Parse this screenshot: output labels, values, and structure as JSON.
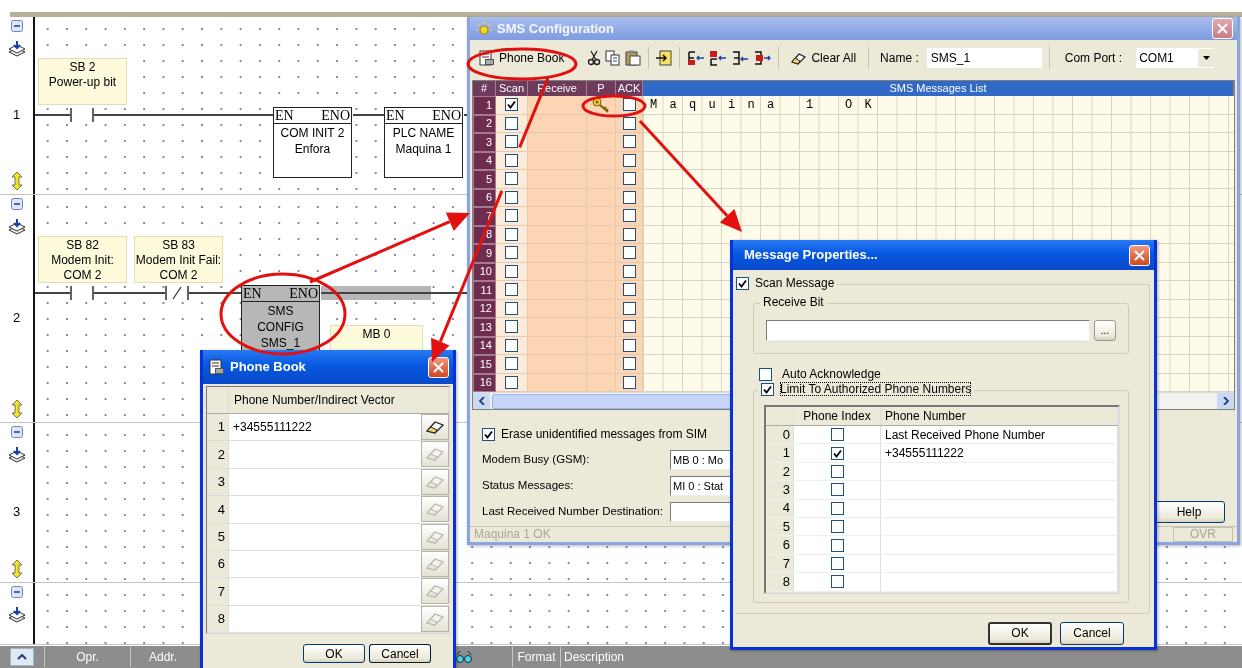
{
  "editor": {
    "rungs": [
      {
        "number": "1",
        "expanded": true,
        "contacts": [
          {
            "text": "SB 2\nPower-up bit",
            "kind": "open"
          }
        ],
        "blocks": [
          {
            "pins": [
              "EN",
              "ENO"
            ],
            "text": "COM INIT 2\nEnfora",
            "selected": false
          },
          {
            "pins": [
              "EN",
              "ENO"
            ],
            "text": "PLC NAME\nMaquina 1",
            "selected": false
          }
        ]
      },
      {
        "number": "2",
        "expanded": true,
        "contacts": [
          {
            "text": "SB 82\nModem Init:\nCOM 2",
            "kind": "open"
          },
          {
            "text": "SB 83\nModem Init Fail:\nCOM 2",
            "kind": "closed"
          }
        ],
        "blocks": [
          {
            "pins": [
              "EN",
              "ENO"
            ],
            "text": "SMS\nCONFIG\nSMS_1",
            "selected": true,
            "tag": "MB 0"
          }
        ]
      },
      {
        "number": "3",
        "expanded": true
      },
      {
        "expanded": true
      }
    ]
  },
  "sms_config": {
    "title": "SMS Configuration",
    "active": false,
    "toolbar": {
      "phone_book": "Phone Book",
      "clear_all": "Clear All",
      "name_label": "Name :",
      "name_value": "SMS_1",
      "com_port_label": "Com Port :",
      "com_port_value": "COM1"
    },
    "grid": {
      "columns": [
        "#",
        "Scan",
        "Receive",
        "P",
        "ACK",
        "SMS Messages List"
      ],
      "rows": [
        {
          "number": "1",
          "scan": true,
          "password": true,
          "ack": false,
          "message": "Maquina 1 OK"
        },
        {
          "number": "2",
          "scan": false,
          "password": false,
          "ack": false
        },
        {
          "number": "3",
          "scan": false,
          "password": false,
          "ack": false
        },
        {
          "number": "4",
          "scan": false,
          "password": false,
          "ack": false
        },
        {
          "number": "5",
          "scan": false,
          "password": false,
          "ack": false
        },
        {
          "number": "6",
          "scan": false,
          "password": false,
          "ack": false
        },
        {
          "number": "7",
          "scan": false,
          "password": false,
          "ack": false
        },
        {
          "number": "8",
          "scan": false,
          "password": false,
          "ack": false
        },
        {
          "number": "9",
          "scan": false,
          "password": false,
          "ack": false
        },
        {
          "number": "10",
          "scan": false,
          "password": false,
          "ack": false
        },
        {
          "number": "11",
          "scan": false,
          "password": false,
          "ack": false
        },
        {
          "number": "12",
          "scan": false,
          "password": false,
          "ack": false
        },
        {
          "number": "13",
          "scan": false,
          "password": false,
          "ack": false
        },
        {
          "number": "14",
          "scan": false,
          "password": false,
          "ack": false
        },
        {
          "number": "15",
          "scan": false,
          "password": false,
          "ack": false
        },
        {
          "number": "16",
          "scan": false,
          "password": false,
          "ack": false
        }
      ]
    },
    "erase_unidentified": {
      "label": "Erase unidentified messages from SIM",
      "checked": true
    },
    "fields": [
      {
        "label": "Modem Busy (GSM):",
        "value": "MB 0 : Mo"
      },
      {
        "label": "Status Messages:",
        "value": "MI 0 : Stat"
      },
      {
        "label": "Last Received Number Destination:"
      }
    ],
    "help": "Help",
    "status": "Maquina 1 OK",
    "mode": "OVR"
  },
  "message_properties": {
    "title": "Message Properties...",
    "active": true,
    "scan_message": {
      "label": "Scan Message",
      "checked": true
    },
    "receive_bit": {
      "legend": "Receive Bit",
      "browse": "..."
    },
    "auto_acknowledge": {
      "label": "Auto Acknowledge",
      "checked": false
    },
    "limit": {
      "label": "Limit To Authorized Phone Numbers",
      "checked": true
    },
    "table": {
      "columns": [
        "Phone Index",
        "Phone Number"
      ],
      "rows": [
        {
          "index": "0",
          "checked": false,
          "number": "Last Received Phone Number"
        },
        {
          "index": "1",
          "checked": true,
          "number": "+34555111222"
        },
        {
          "index": "2",
          "checked": false
        },
        {
          "index": "3",
          "checked": false
        },
        {
          "index": "4",
          "checked": false
        },
        {
          "index": "5",
          "checked": false
        },
        {
          "index": "6",
          "checked": false
        },
        {
          "index": "7",
          "checked": false
        },
        {
          "index": "8",
          "checked": false
        }
      ]
    },
    "buttons": [
      "OK",
      "Cancel"
    ]
  },
  "phone_book": {
    "title": "Phone Book",
    "active": true,
    "column": "Phone Number/Indirect Vector",
    "rows": [
      {
        "index": "1",
        "number": "+34555111222",
        "disabled": false
      },
      {
        "index": "2",
        "disabled": true
      },
      {
        "index": "3",
        "disabled": true
      },
      {
        "index": "4",
        "disabled": true
      },
      {
        "index": "5",
        "disabled": true
      },
      {
        "index": "6",
        "disabled": true
      },
      {
        "index": "7",
        "disabled": true
      },
      {
        "index": "8",
        "disabled": true
      }
    ],
    "buttons": [
      "OK",
      "Cancel"
    ]
  },
  "footer": {
    "columns": [
      "Opr.",
      "Addr.",
      "Format",
      "Description"
    ]
  }
}
